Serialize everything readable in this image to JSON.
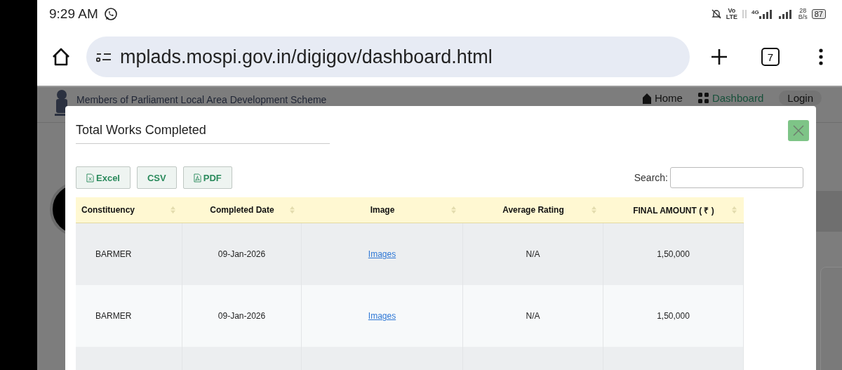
{
  "status_bar": {
    "time": "9:29 AM",
    "network_type": "4G",
    "volte": "Vo",
    "lte": "LTE",
    "speed_value": "28",
    "speed_unit": "B/s",
    "battery": "87"
  },
  "browser": {
    "url": "mplads.mospi.gov.in/digigov/dashboard.html",
    "tab_count": "7"
  },
  "site": {
    "title": "Members of Parliament Local Area Development Scheme",
    "nav": [
      {
        "label": "Home",
        "kind": "home",
        "selected": false
      },
      {
        "label": "Dashboard",
        "kind": "dashboard",
        "selected": true
      }
    ],
    "login": "Login"
  },
  "modal": {
    "title": "Total Works Completed",
    "export_buttons": [
      {
        "label": "Excel",
        "kind": "excel"
      },
      {
        "label": "CSV",
        "kind": "csv"
      },
      {
        "label": "PDF",
        "kind": "pdf"
      }
    ],
    "search": {
      "label": "Search:"
    },
    "table": {
      "columns": [
        "Constituency",
        "Completed Date",
        "Image",
        "Average Rating",
        "FINAL AMOUNT ( ₹ )"
      ],
      "rows": [
        {
          "constituency": "BARMER",
          "completed_date": "09-Jan-2026",
          "image": "Images",
          "average_rating": "N/A",
          "final_amount": "1,50,000"
        },
        {
          "constituency": "BARMER",
          "completed_date": "09-Jan-2026",
          "image": "Images",
          "average_rating": "N/A",
          "final_amount": "1,50,000"
        }
      ]
    }
  }
}
